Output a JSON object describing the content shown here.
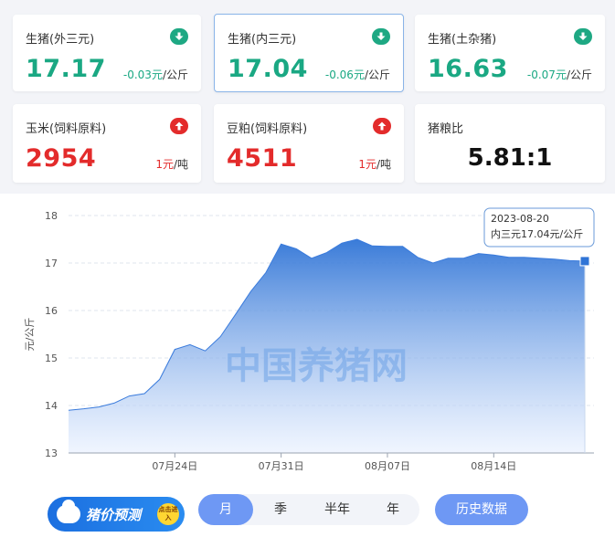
{
  "cards": [
    {
      "name": "生猪(外三元)",
      "value": "17.17",
      "change": "-0.03元",
      "unit": "/公斤",
      "trend": "down"
    },
    {
      "name": "生猪(内三元)",
      "value": "17.04",
      "change": "-0.06元",
      "unit": "/公斤",
      "trend": "down"
    },
    {
      "name": "生猪(土杂猪)",
      "value": "16.63",
      "change": "-0.07元",
      "unit": "/公斤",
      "trend": "down"
    },
    {
      "name": "玉米(饲料原料)",
      "value": "2954",
      "change": "1元",
      "unit": "/吨",
      "trend": "up"
    },
    {
      "name": "豆粕(饲料原料)",
      "value": "4511",
      "change": "1元",
      "unit": "/吨",
      "trend": "up"
    },
    {
      "name": "猪粮比",
      "value": "5.81:1"
    }
  ],
  "colors": {
    "down": "#1aa883",
    "up": "#e32b2b",
    "area_top": "#2f74d6",
    "area_bottom": "#e6efff",
    "accent": "#6e98f4"
  },
  "chart_data": {
    "type": "area",
    "ylabel": "元/公斤",
    "ylim": [
      13,
      18
    ],
    "yticks": [
      13,
      14,
      15,
      16,
      17,
      18
    ],
    "x_ticks": [
      "07月24日",
      "07月31日",
      "08月07日",
      "08月14日"
    ],
    "x_tick_index": [
      7,
      14,
      21,
      28
    ],
    "watermark": "中国养猪网",
    "series": [
      {
        "x": [
          "07-17",
          "07-18",
          "07-19",
          "07-20",
          "07-21",
          "07-22",
          "07-23",
          "07-24",
          "07-25",
          "07-26",
          "07-27",
          "07-28",
          "07-29",
          "07-30",
          "07-31",
          "08-01",
          "08-02",
          "08-03",
          "08-04",
          "08-05",
          "08-06",
          "08-07",
          "08-08",
          "08-09",
          "08-10",
          "08-11",
          "08-12",
          "08-13",
          "08-14",
          "08-15",
          "08-16",
          "08-17",
          "08-18",
          "08-19",
          "08-20"
        ],
        "values": [
          13.9,
          13.93,
          13.97,
          14.05,
          14.2,
          14.25,
          14.55,
          15.18,
          15.28,
          15.15,
          15.45,
          15.92,
          16.4,
          16.8,
          17.4,
          17.3,
          17.1,
          17.22,
          17.42,
          17.5,
          17.36,
          17.35,
          17.35,
          17.12,
          17.0,
          17.1,
          17.1,
          17.2,
          17.17,
          17.12,
          17.12,
          17.1,
          17.08,
          17.05,
          17.04
        ]
      }
    ],
    "tooltip": {
      "date": "2023-08-20",
      "text": "内三元17.04元/公斤"
    }
  },
  "controls": {
    "promo_label": "猪价预测",
    "promo_badge": "点击进入",
    "periods": [
      "月",
      "季",
      "半年",
      "年"
    ],
    "active_period": "月",
    "history_label": "历史数据"
  }
}
